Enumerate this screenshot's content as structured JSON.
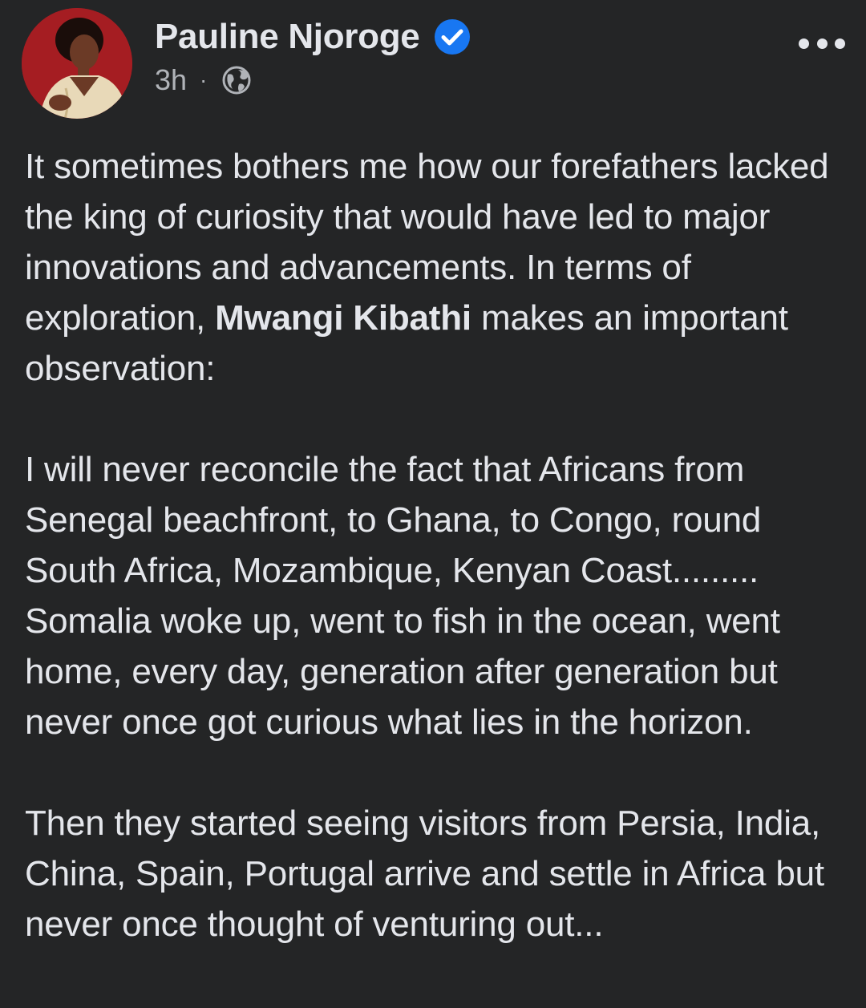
{
  "post": {
    "author": {
      "name": "Pauline Njoroge",
      "verified_icon": "verified-badge-icon",
      "avatar_icon": "avatar"
    },
    "timestamp": "3h",
    "separator": "·",
    "audience_icon": "globe-icon",
    "more_icon": "more-options-icon",
    "body": {
      "para1_before": "It sometimes bothers me how our forefathers lacked the king of curiosity that would have led to major innovations and advancements. In terms of exploration, ",
      "mention": "Mwangi Kibathi",
      "para1_after": " makes an important observation:",
      "para2": "I will never reconcile the fact that Africans from Senegal beachfront, to Ghana, to Congo, round South Africa, Mozambique, Kenyan Coast......... Somalia woke up, went to fish in the ocean, went home, every day, generation after generation but never once got curious what lies in the horizon.",
      "para3": "Then they started seeing visitors from Persia, India, China, Spain, Portugal arrive and settle in Africa but never once thought of venturing out..."
    }
  },
  "colors": {
    "background": "#242526",
    "primary_text": "#e4e6eb",
    "secondary_text": "#b0b3b8",
    "verified_blue": "#1877f2",
    "avatar_bg": "#a51d22"
  }
}
